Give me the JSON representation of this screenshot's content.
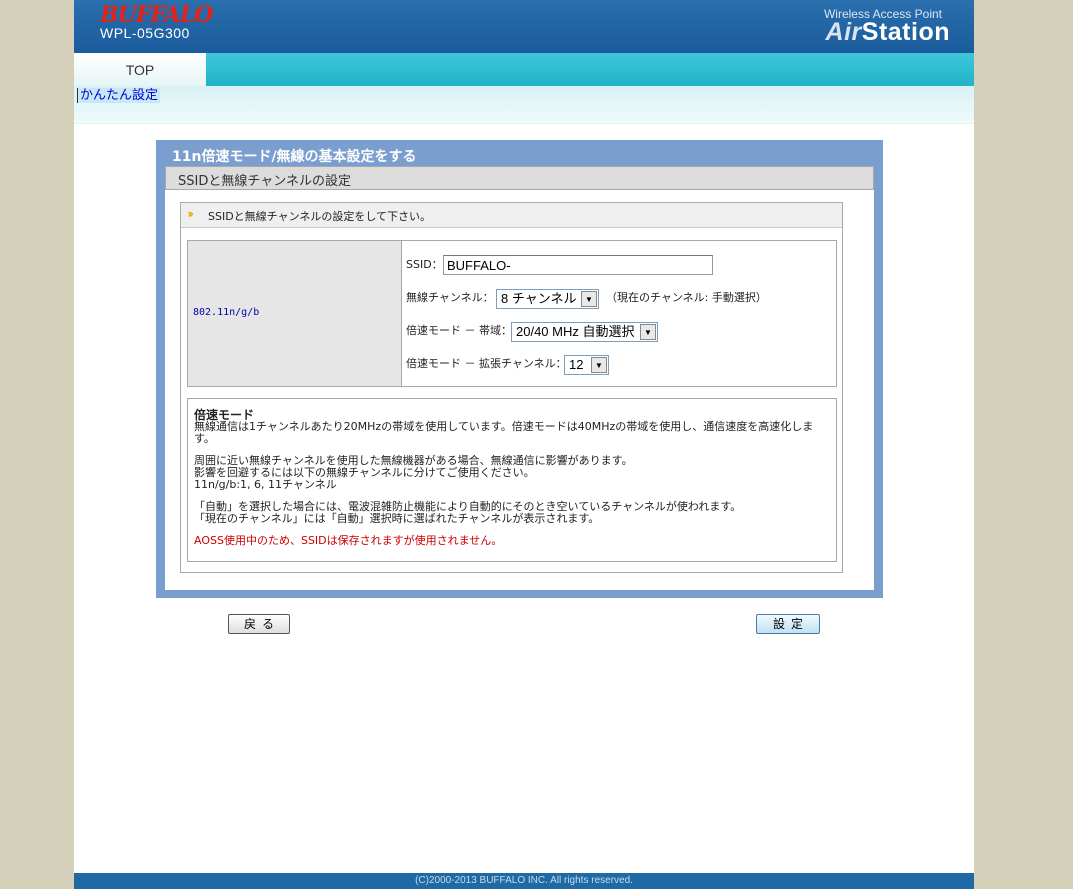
{
  "header": {
    "brand": "BUFFALO",
    "model": "WPL-05G300",
    "product_subtitle": "Wireless Access Point",
    "product_name_a": "Air",
    "product_name_b": "Station"
  },
  "nav": {
    "top_tab": "TOP",
    "subnav_link": "かんたん設定"
  },
  "panel": {
    "title": "11n倍速モード/無線の基本設定をする",
    "section_title": "SSIDと無線チャンネルの設定",
    "instruction": "SSIDと無線チャンネルの設定をして下さい。"
  },
  "settings": {
    "standard": "802.11n/g/b",
    "ssid_label": "SSID：",
    "ssid_value": "BUFFALO-",
    "channel_label": "無線チャンネル：",
    "channel_value": "8 チャンネル",
    "current_channel_note": "（現在のチャンネル: 手動選択）",
    "bandwidth_label": "倍速モード － 帯域：",
    "bandwidth_value": "20/40 MHz 自動選択",
    "ext_channel_label": "倍速モード － 拡張チャンネル：",
    "ext_channel_value": "12"
  },
  "notes": {
    "title": "倍速モード",
    "line1": "無線通信は1チャンネルあたり20MHzの帯域を使用しています。倍速モードは40MHzの帯域を使用し、通信速度を高速化しま",
    "line1b": "す。",
    "line2": "周囲に近い無線チャンネルを使用した無線機器がある場合、無線通信に影響があります。",
    "line3": "影響を回避するには以下の無線チャンネルに分けてご使用ください。",
    "line4": "11n/g/b:1, 6, 11チャンネル",
    "line5": "「自動」を選択した場合には、電波混雑防止機能により自動的にそのとき空いているチャンネルが使われます。",
    "line6": "「現在のチャンネル」には「自動」選択時に選ばれたチャンネルが表示されます。",
    "aoss_warning": "AOSS使用中のため、SSIDは保存されますが使用されません。"
  },
  "buttons": {
    "back": "戻る",
    "set": "設定"
  },
  "footer": "(C)2000-2013 BUFFALO INC. All rights reserved."
}
